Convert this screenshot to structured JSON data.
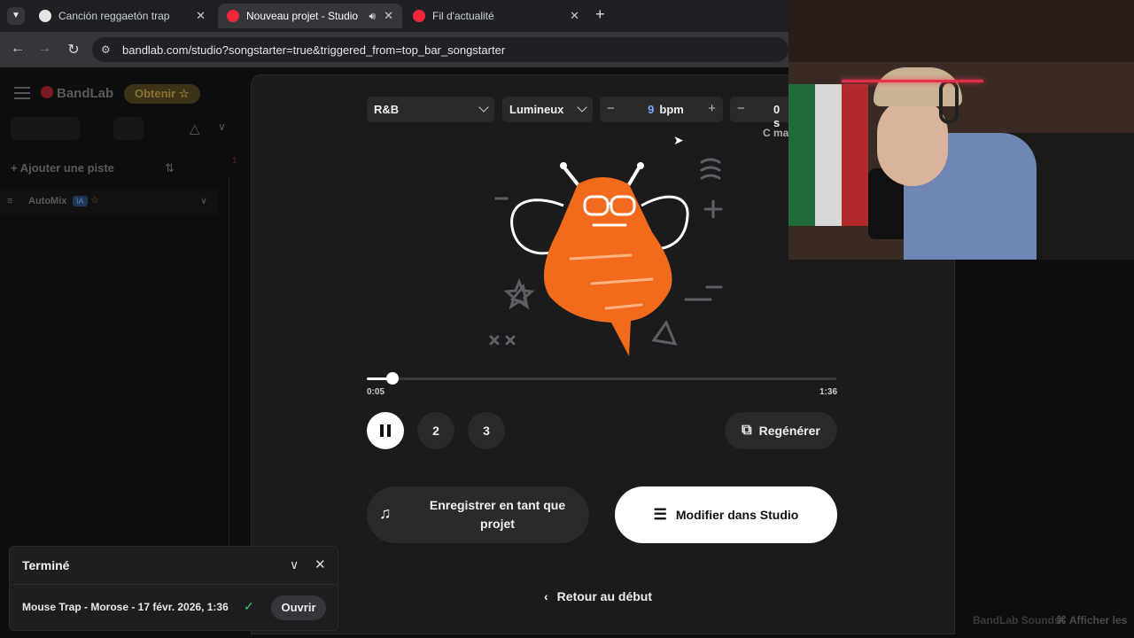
{
  "browser": {
    "tabs": [
      {
        "title": "Canción reggaetón trap",
        "active": false,
        "favicon": "openai-icon"
      },
      {
        "title": "Nouveau projet - Studio",
        "active": true,
        "favicon": "bandlab-icon"
      },
      {
        "title": "Fil d'actualité",
        "active": false,
        "favicon": "bandlab-icon"
      }
    ],
    "url": "bandlab.com/studio?songstarter=true&triggered_from=top_bar_songstarter"
  },
  "app": {
    "brand": "BandLab",
    "get_button": "Obtenir",
    "add_track": "Ajouter une piste",
    "automix": "AutoMix",
    "automix_badge": "IA",
    "ruler_mark": "1",
    "footer_sounds": "BandLab Sounds",
    "footer_show": "Afficher les"
  },
  "songstarter": {
    "genre": "R&B",
    "mood": "Lumineux",
    "bpm_value": "9",
    "bpm_unit": "bpm",
    "duration_value": "0 s",
    "key_label": "C ma",
    "progress": {
      "current": "0:05",
      "total": "1:36",
      "fraction": 0.055
    },
    "variants": [
      "2",
      "3"
    ],
    "regenerate_label": "Regénérer",
    "save_label": "Enregistrer en tant que projet",
    "edit_label": "Modifier dans Studio",
    "back_label": "Retour au début"
  },
  "toast": {
    "title": "Terminé",
    "item": "Mouse Trap - Morose - 17 févr. 2026, 1:36",
    "open_label": "Ouvrir"
  },
  "colors": {
    "bee_orange": "#f26b1d",
    "bandlab_red": "#f0263a",
    "gold": "#e0b53d"
  }
}
